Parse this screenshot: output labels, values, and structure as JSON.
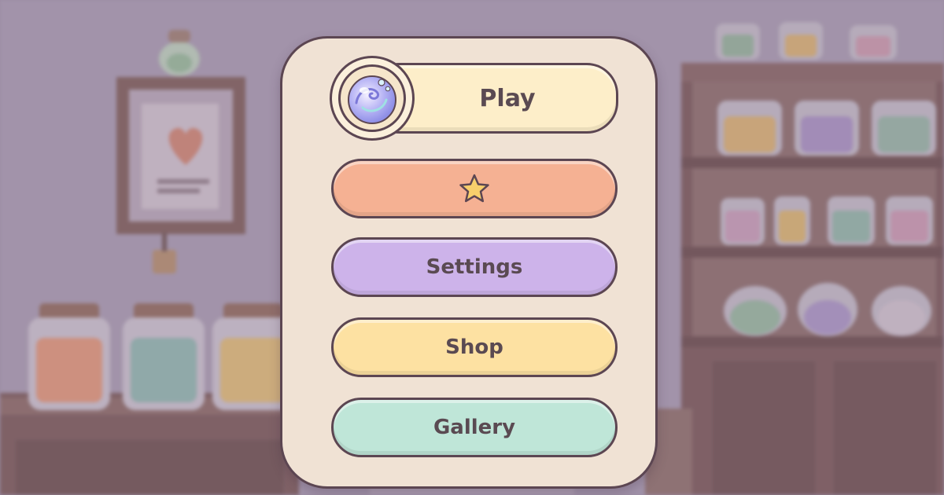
{
  "menu": {
    "play_label": "Play",
    "settings_label": "Settings",
    "shop_label": "Shop",
    "gallery_label": "Gallery",
    "favorites_icon": "star-icon",
    "play_icon": "slime-orb-icon"
  },
  "colors": {
    "panel": "#f0e2d4",
    "outline": "#5c4652",
    "play": "#fdeec9",
    "favorites": "#f5b193",
    "settings": "#cdb3ea",
    "shop": "#fde1a2",
    "gallery": "#bfe6d8"
  }
}
